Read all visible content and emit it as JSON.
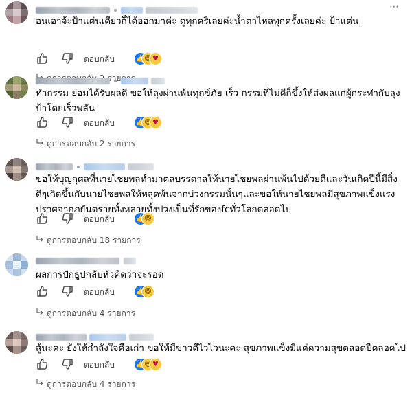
{
  "comments": [
    {
      "text": "อนเอาจ้ะป้าแต่นเดียวก็ได้ออกมาค่ะ ดูทุกคริเลยค่ะน้ำตาไหลทุกครั้งเลยค่ะ ป้าแต่น",
      "reply_label": "ตอบกลับ",
      "replies_label": "ดูการตอบกลับ 2 รายการ",
      "reactions": [
        "like",
        "haha",
        "care"
      ]
    },
    {
      "text": "ทำกรรม ย่อมได้รับผลดี ขอให้ลุงผ่านพ้นทุกข์ภัย เร็ว กรรมที่ไม่ดีก็ขึ้งให้ส่งผลแก่ผู้กระทำกับลุงป้าโดยเร็วพลัน",
      "reply_label": "ตอบกลับ",
      "replies_label": "ดูการตอบกลับ 2 รายการ",
      "reactions": [
        "like",
        "haha",
        "care"
      ]
    },
    {
      "text": "ขอให้บุญกุศลที่นายไชยพลทำมาตลบรรดาลให้นายไชยพลผ่านพ้นไปด้วยดีและวันเกิดปีนี้มีสิ่งดีๆเกิดขึ้นกับนายไชยพลให้หลุดพ้นจากบ่วงกรรมนั้นๆและขอให้นายไชยพลมีสุขภาพแข็งแรงปราศจากภยันตรายทั้งหลายทั้งปวงเป็นที่รักของfcทั่วโลกตลอดไป",
      "reply_label": "ตอบกลับ",
      "replies_label": "ดูการตอบกลับ 18 รายการ",
      "reactions": [
        "like",
        "haha"
      ]
    },
    {
      "text": "ผลการปักธูปกลับหัวคิดว่าจะรอด",
      "reply_label": "ตอบกลับ",
      "replies_label": "ดูการตอบกลับ 4 รายการ",
      "reactions": [
        "like",
        "haha"
      ]
    },
    {
      "text": "สู้นะคะ ยังให้กำลังใจคือเก่า ขอให้มีข่าวดีไวไวนะคะ สุขภาพแข็งมีแต่ความสุขตลอดปีตลอดไป",
      "reply_label": "ตอบกลับ",
      "replies_label": "ดูการตอบกลับ 4 รายการ",
      "reactions": [
        "like",
        "haha",
        "care"
      ]
    }
  ],
  "colors": {
    "like": "#1877f2",
    "haha": "#f7c940",
    "care": "#e0245e",
    "text": "#050505",
    "secondary": "#65676b"
  }
}
